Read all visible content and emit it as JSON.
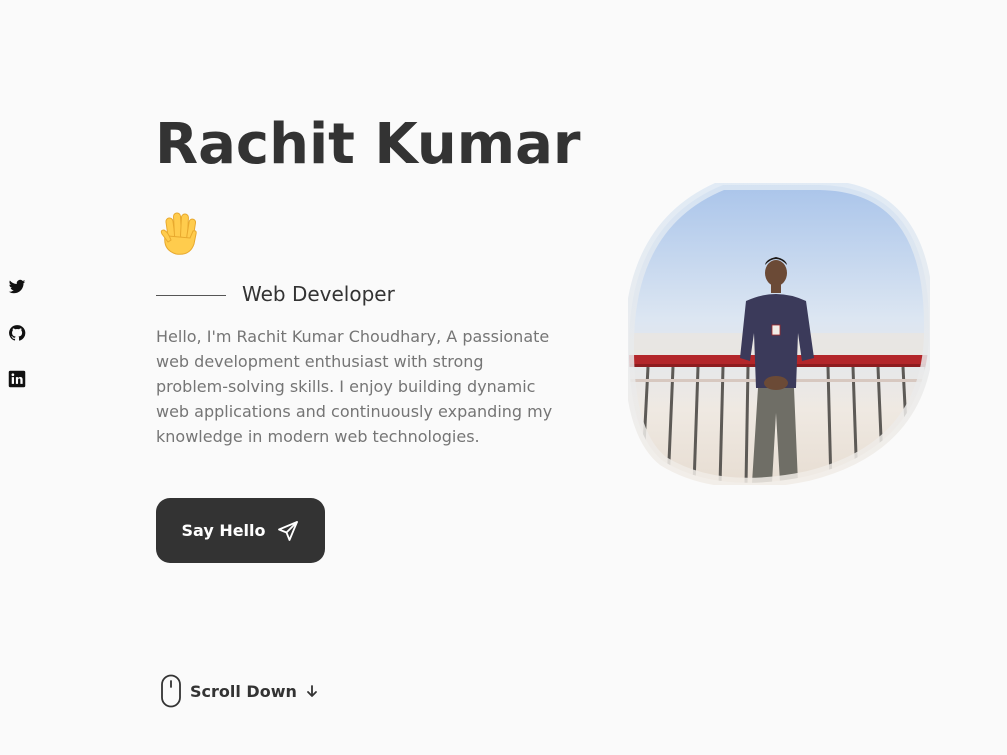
{
  "hero": {
    "name": "Rachit Kumar",
    "wave_icon": "waving-hand-emoji",
    "subtitle": "Web Developer",
    "description": "Hello, I'm Rachit Kumar Choudhary, A passionate web development enthusiast with strong problem-solving skills. I enjoy building dynamic web applications and continuously expanding my knowledge in modern web technologies.",
    "cta_label": "Say Hello",
    "cta_icon": "send-icon"
  },
  "social": {
    "items": [
      {
        "icon": "twitter-icon"
      },
      {
        "icon": "github-icon"
      },
      {
        "icon": "linkedin-icon"
      }
    ]
  },
  "scroll": {
    "label": "Scroll Down",
    "icon": "mouse-icon",
    "arrow_icon": "arrow-down-icon"
  },
  "profile": {
    "image": "profile-photo"
  },
  "colors": {
    "background": "#fafafa",
    "text": "#333333",
    "muted": "#757575",
    "button": "#333333"
  }
}
